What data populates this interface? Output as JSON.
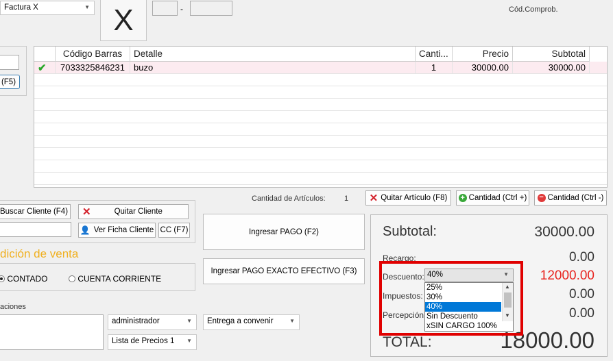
{
  "doc_type_combo": "Factura X",
  "doc_letter": "X",
  "doc_separator": "-",
  "cod_comprob_label": "Cód.Comprob.",
  "left_top_button": "(F5)",
  "grid": {
    "headers": [
      "Código Barras",
      "Detalle",
      "Canti...",
      "Precio",
      "Subtotal"
    ],
    "rows": [
      {
        "codigo": "7033325846231",
        "detalle": "buzo",
        "cantidad": "1",
        "precio": "30000.00",
        "subtotal": "30000.00"
      }
    ]
  },
  "cantidad_articulos_label": "Cantidad de Artículos:",
  "cantidad_articulos_value": "1",
  "quitar_articulo_button": "Quitar Artículo (F8)",
  "cantidad_plus_button": "Cantidad (Ctrl +)",
  "cantidad_minus_button": "Cantidad (Ctrl -)",
  "buscar_cliente_button": "Buscar Cliente (F4)",
  "quitar_cliente_button": "Quitar Cliente",
  "ver_ficha_button": "Ver Ficha Cliente",
  "cc_button": "CC (F7)",
  "condicion_venta_label": "dición de venta",
  "contado_label": "CONTADO",
  "cuenta_corriente_label": "CUENTA CORRIENTE",
  "observaciones_label": "aciones",
  "usuario_combo": "administrador",
  "entrega_combo": "Entrega a convenir",
  "lista_precios_combo": "Lista de Precios 1",
  "ingresar_pago_button": "Ingresar PAGO (F2)",
  "ingresar_pago_exacto_button": "Ingresar PAGO EXACTO EFECTIVO (F3)",
  "totals": {
    "subtotal_label": "Subtotal:",
    "subtotal_value": "30000.00",
    "recargo_label": "Recargo:",
    "recargo_value": "0.00",
    "descuento_label": "Descuento:",
    "descuento_value": "12000.00",
    "impuestos_label": "Impuestos:",
    "impuestos_value": "0.00",
    "percepcion_label": "Percepción:",
    "percepcion_value": "0.00",
    "total_label": "TOTAL:",
    "total_value": "18000.00"
  },
  "descuento_dropdown": {
    "selected": "40%",
    "options": [
      "25%",
      "30%",
      "40%",
      "Sin Descuento",
      "xSIN CARGO 100%"
    ],
    "highlighted_index": 2
  },
  "colors": {
    "descuento_red": "#e8231e",
    "highlight_box": "#e00000",
    "condicion_orange": "#f0b020",
    "check_green": "#2ca82c"
  }
}
